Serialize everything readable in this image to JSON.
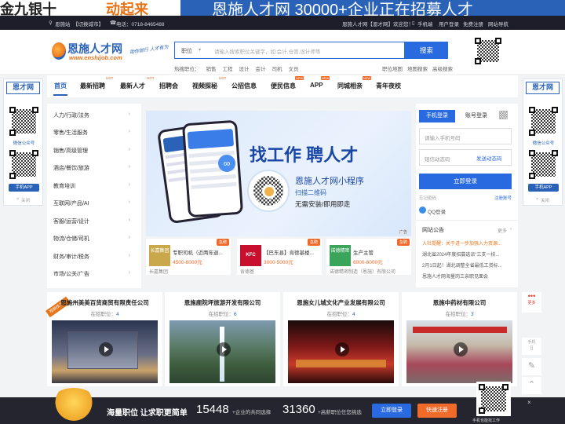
{
  "banner": {
    "left_text": "金九银十",
    "accent_text": "动起来",
    "right_text": "恩施人才网 30000+企业正在招募人才"
  },
  "topbar": {
    "location": "恩施站",
    "switch_city": "【切换城市】",
    "phone": "电话：0718-8465488",
    "welcome": "恩施人才网【恩才网】欢迎您！",
    "mobile": "手机端",
    "user_login": "用户登录",
    "free_register": "免费注册",
    "nav_site": "网站导航"
  },
  "logo": {
    "title": "恩施人才网",
    "url": "www.enshijob.com",
    "slogan": "助你前行 人才有为"
  },
  "search": {
    "select": "职位",
    "placeholder": "请输入搜索职位关键字，如:会计,仓管,设计师等",
    "button": "搜索",
    "hot_label": "热搜职位：",
    "hot_terms": [
      "销售",
      "工程",
      "设计",
      "会计",
      "司机",
      "文员"
    ],
    "links": [
      "职位地图",
      "地图搜索",
      "高级搜索"
    ]
  },
  "nav": {
    "items": [
      {
        "label": "首页",
        "badge": ""
      },
      {
        "label": "最新招聘",
        "badge": "HOT"
      },
      {
        "label": "最新人才",
        "badge": "HOT"
      },
      {
        "label": "招聘会",
        "badge": ""
      },
      {
        "label": "视频探秘",
        "badge": "HOT"
      },
      {
        "label": "公招信息",
        "badge": ""
      },
      {
        "label": "便民信息",
        "badge": "NEW"
      },
      {
        "label": "APP",
        "badge": "NEW"
      },
      {
        "label": "同城相亲",
        "badge": "NEW"
      },
      {
        "label": "青年夜校",
        "badge": ""
      }
    ]
  },
  "categories": [
    "人力/行政/法务",
    "零售/生活服务",
    "销售/高级管理",
    "酒店/餐饮/旅游",
    "教育培训",
    "互联网/产品/AI",
    "客服/运营/设计",
    "物流/仓储/司机",
    "财务/审计/税务",
    "市场/公关/广告"
  ],
  "hero": {
    "title": "找工作 聘人才",
    "subtitle": "恩施人才网小程序",
    "scan": "扫描二维码",
    "tagline": "无需安装/即用即走",
    "ad": "广告"
  },
  "jobs": [
    {
      "title": "专职司机（近两年退...",
      "salary": "4500-6000元",
      "company": "长嘉集团",
      "logo": "长嘉集团",
      "badge": "急聘"
    },
    {
      "title": "【巴东县】肯德基楼...",
      "salary": "3000-5000元",
      "company": "肯德基",
      "logo": "KFC",
      "badge": "急聘"
    },
    {
      "title": "生产主管",
      "salary": "6000-8000元",
      "company": "诺德精密制造（恩施）有限公司",
      "logo": "诺德精密",
      "badge": "急聘"
    }
  ],
  "login": {
    "tab_mobile": "手机登录",
    "tab_account": "账号登录",
    "phone_ph": "请输入手机号码",
    "code_ph": "短信动态码",
    "send_code": "发送动态码",
    "button": "立即登录",
    "forgot": "忘记密码",
    "register": "注册账号",
    "qq": "QQ登录"
  },
  "notice": {
    "title": "网站公告",
    "more": "更多",
    "items": [
      "入社提醒：关于进一步加强入力资源...",
      "湖北省2024年度招募选派“三支一扶...",
      "2月1日起！湖北调整全省最低工资标...",
      "恩施人才网海量岗三亲职见面会"
    ]
  },
  "side": {
    "title": "恩才网",
    "wechat": "微信公众号",
    "app": "手机APP",
    "close": "关闭"
  },
  "companies": [
    {
      "name": "恩施州美美百货商贸有限责任公司",
      "count_label": "在招职位：",
      "count": "4",
      "tag": "视频找工作"
    },
    {
      "name": "恩施鹿院坪旅游开发有限公司",
      "count_label": "在招职位：",
      "count": "6",
      "tag": ""
    },
    {
      "name": "恩施女儿城文化产业发展有限公司",
      "count_label": "在招职位：",
      "count": "4",
      "tag": ""
    },
    {
      "name": "恩施中药材有限公司",
      "count_label": "在招职位：",
      "count": "3",
      "tag": ""
    }
  ],
  "tools": {
    "more": "更多",
    "buttons": [
      "手机",
      "编辑",
      "顶部"
    ]
  },
  "bottom": {
    "slogan": "海量职位 让求职更简单",
    "num1": "15448",
    "label1": "+企业的共同选择",
    "num2": "31360",
    "label2": "+高薪职位任您挑选",
    "login": "立即登录",
    "register": "快速注册",
    "qr_caption": "手机也能找工作"
  }
}
